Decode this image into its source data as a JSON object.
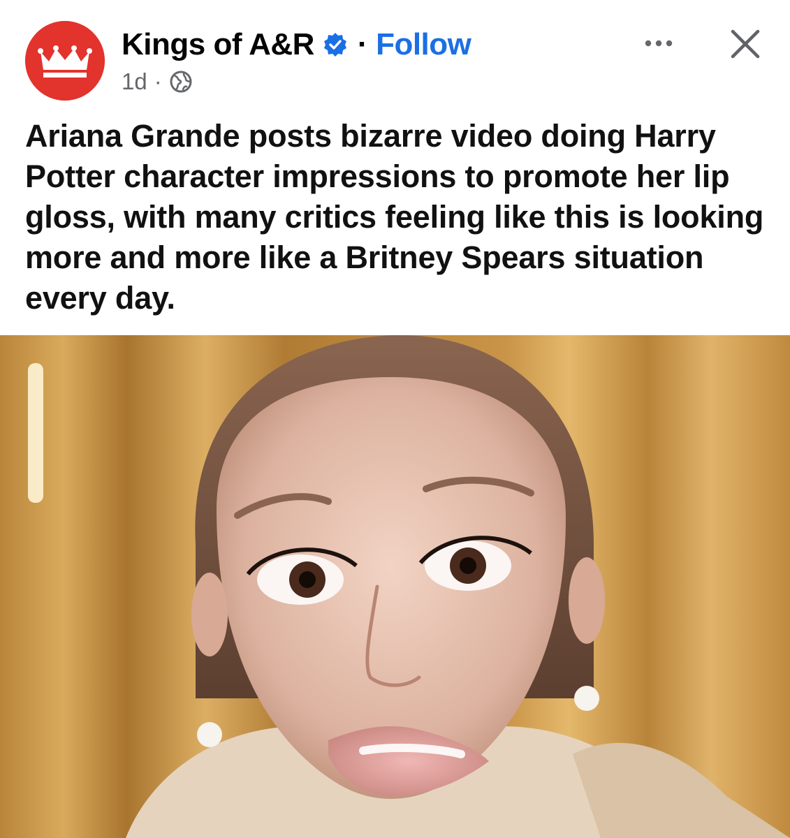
{
  "post": {
    "page_name": "Kings of A&R",
    "separator": "·",
    "follow_label": "Follow",
    "timestamp": "1d",
    "meta_separator": "·",
    "caption": "Ariana Grande posts bizarre video doing Harry Potter character impressions to promote her lip gloss, with many critics feeling like this is looking more and more like a Britney Spears situation every day."
  },
  "icons": {
    "avatar": "crown-logo",
    "verified": "verified-badge-icon",
    "audience": "globe-icon",
    "more": "more-options-icon",
    "close": "close-icon"
  },
  "colors": {
    "brand_red": "#e2332c",
    "follow_blue": "#1b6fe4",
    "verified_blue": "#1b6fe4",
    "meta_gray": "#65676b"
  }
}
